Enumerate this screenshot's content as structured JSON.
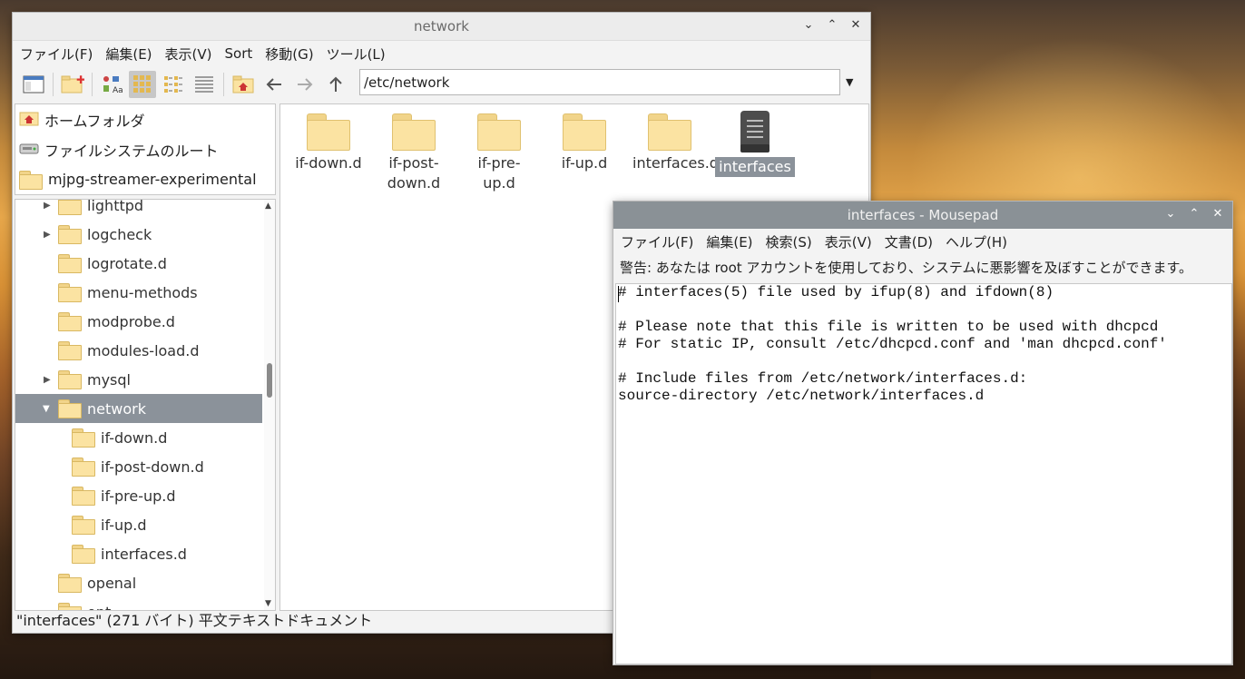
{
  "file_manager": {
    "title": "network",
    "menu": [
      "ファイル(F)",
      "編集(E)",
      "表示(V)",
      "Sort",
      "移動(G)",
      "ツール(L)"
    ],
    "path": "/etc/network",
    "places": [
      {
        "label": "ホームフォルダ",
        "icon": "home-icon"
      },
      {
        "label": "ファイルシステムのルート",
        "icon": "drive-icon"
      },
      {
        "label": "mjpg-streamer-experimental",
        "icon": "folder-icon"
      }
    ],
    "tree": [
      {
        "label": "lighttpd",
        "expander": "right"
      },
      {
        "label": "logcheck",
        "expander": "right"
      },
      {
        "label": "logrotate.d",
        "expander": ""
      },
      {
        "label": "menu-methods",
        "expander": ""
      },
      {
        "label": "modprobe.d",
        "expander": ""
      },
      {
        "label": "modules-load.d",
        "expander": ""
      },
      {
        "label": "mysql",
        "expander": "right"
      },
      {
        "label": "network",
        "expander": "down",
        "selected": true
      },
      {
        "label": "if-down.d",
        "expander": "",
        "child": true
      },
      {
        "label": "if-post-down.d",
        "expander": "",
        "child": true
      },
      {
        "label": "if-pre-up.d",
        "expander": "",
        "child": true
      },
      {
        "label": "if-up.d",
        "expander": "",
        "child": true
      },
      {
        "label": "interfaces.d",
        "expander": "",
        "child": true
      },
      {
        "label": "openal",
        "expander": ""
      },
      {
        "label": "opt",
        "expander": ""
      }
    ],
    "items": [
      {
        "label1": "if-down.d",
        "label2": "",
        "type": "folder"
      },
      {
        "label1": "if-post-",
        "label2": "down.d",
        "type": "folder"
      },
      {
        "label1": "if-pre-up.d",
        "label2": "",
        "type": "folder"
      },
      {
        "label1": "if-up.d",
        "label2": "",
        "type": "folder"
      },
      {
        "label1": "interfaces.d",
        "label2": "",
        "type": "folder"
      },
      {
        "label1": "interfaces",
        "label2": "",
        "type": "text-file",
        "selected": true
      }
    ],
    "status": "\"interfaces\" (271 バイト) 平文テキストドキュメント"
  },
  "mousepad": {
    "title": "interfaces - Mousepad",
    "menu": [
      "ファイル(F)",
      "編集(E)",
      "検索(S)",
      "表示(V)",
      "文書(D)",
      "ヘルプ(H)"
    ],
    "warning": "警告: あなたは root アカウントを使用しており、システムに悪影響を及ぼすことができます。",
    "content": "# interfaces(5) file used by ifup(8) and ifdown(8)\n\n# Please note that this file is written to be used with dhcpcd\n# For static IP, consult /etc/dhcpcd.conf and 'man dhcpcd.conf'\n\n# Include files from /etc/network/interfaces.d:\nsource-directory /etc/network/interfaces.d"
  },
  "window_buttons": {
    "minimize": "⌄",
    "maximize": "⌃",
    "close": "✕"
  }
}
